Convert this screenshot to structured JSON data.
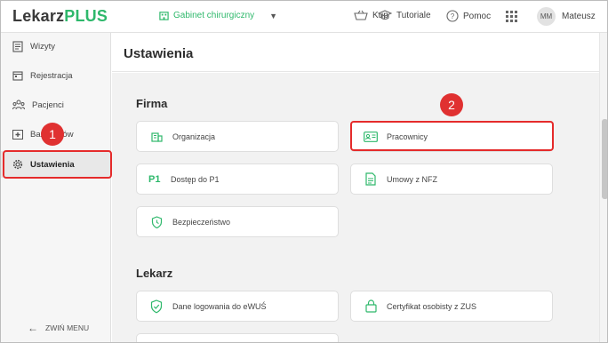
{
  "app": {
    "logo_part1": "Lekarz",
    "logo_part2": "PLUS"
  },
  "topbar": {
    "facility": "Gabinet chirurgiczny",
    "buy": "Kup",
    "tutorials": "Tutoriale",
    "help": "Pomoc",
    "user_initials": "MM",
    "user_name": "Mateusz"
  },
  "sidebar": {
    "items": [
      {
        "label": "Wizyty",
        "icon": "clipboard-icon"
      },
      {
        "label": "Rejestracja",
        "icon": "calendar-icon"
      },
      {
        "label": "Pacjenci",
        "icon": "people-icon"
      },
      {
        "label": "Baza leków",
        "icon": "medicine-box-icon"
      },
      {
        "label": "Ustawienia",
        "icon": "gear-icon",
        "active": true
      }
    ],
    "collapse_label": "ZWIŃ MENU"
  },
  "page": {
    "title": "Ustawienia"
  },
  "sections": {
    "firma": {
      "title": "Firma",
      "cards": [
        {
          "label": "Organizacja",
          "icon": "building-icon"
        },
        {
          "label": "Pracownicy",
          "icon": "id-card-icon"
        },
        {
          "label": "Dostęp do P1",
          "prefix": "P1"
        },
        {
          "label": "Umowy z NFZ",
          "icon": "document-icon"
        },
        {
          "label": "Bezpieczeństwo",
          "icon": "shield-clock-icon"
        }
      ]
    },
    "lekarz": {
      "title": "Lekarz",
      "cards": [
        {
          "label": "Dane logowania do eWUŚ",
          "icon": "shield-check-icon"
        },
        {
          "label": "Certyfikat osobisty z ZUS",
          "icon": "lock-icon"
        }
      ]
    }
  },
  "annotations": {
    "badge1": "1",
    "badge2": "2"
  },
  "colors": {
    "brand": "#2eb86b",
    "highlight": "#e52b2b"
  }
}
